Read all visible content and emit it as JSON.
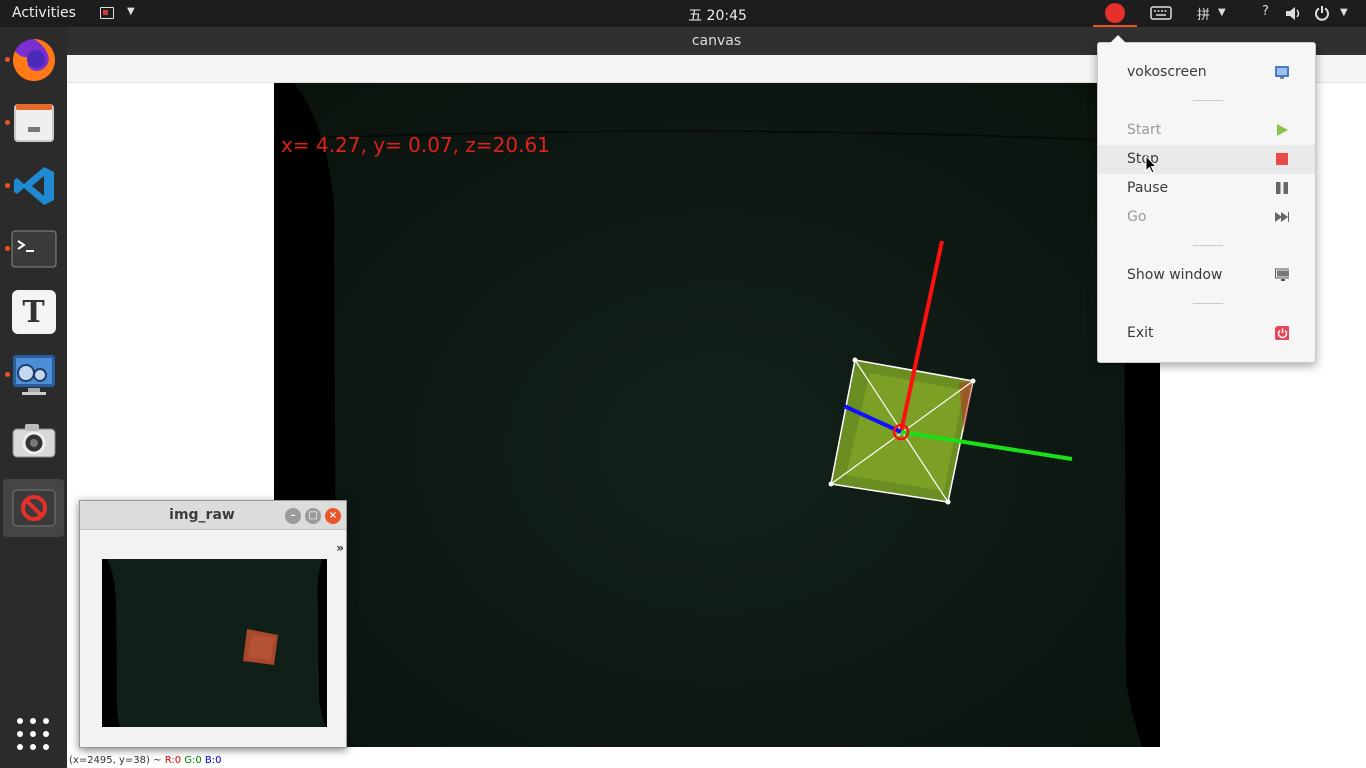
{
  "topbar": {
    "activities": "Activities",
    "clock": "五 20:45",
    "input_method": "拼",
    "help": "?",
    "accent_color": "#e95420"
  },
  "dock": {
    "items": [
      {
        "name": "firefox-icon",
        "running": true
      },
      {
        "name": "files-icon",
        "running": true
      },
      {
        "name": "vscode-icon",
        "running": true
      },
      {
        "name": "terminal-icon",
        "running": true
      },
      {
        "name": "text-editor-icon",
        "running": false
      },
      {
        "name": "video-recorder-icon",
        "running": true
      },
      {
        "name": "camera-icon",
        "running": false
      },
      {
        "name": "vokoscreen-icon",
        "running": false,
        "active": true
      }
    ],
    "apps_grid": "show-applications-icon"
  },
  "canvas_window": {
    "title": "canvas",
    "pose_text": "x= 4.27, y= 0.07, z=20.61",
    "pose_color": "#e0201a",
    "status": {
      "coords": "(x=2495, y=38) ~",
      "r": "R:0",
      "g": "G:0",
      "b": "B:0"
    }
  },
  "imgraw_window": {
    "title": "img_raw",
    "more": "»"
  },
  "tray_menu": {
    "items": [
      {
        "label": "vokoscreen",
        "icon": "vokoscreen-icon",
        "enabled": true
      },
      {
        "label": "Start",
        "icon": "play-icon",
        "enabled": false
      },
      {
        "label": "Stop",
        "icon": "stop-icon",
        "enabled": true
      },
      {
        "label": "Pause",
        "icon": "pause-icon",
        "enabled": true
      },
      {
        "label": "Go",
        "icon": "fast-forward-icon",
        "enabled": false
      },
      {
        "label": "Show window",
        "icon": "monitor-icon",
        "enabled": true
      },
      {
        "label": "Exit",
        "icon": "power-icon",
        "enabled": true
      }
    ]
  }
}
